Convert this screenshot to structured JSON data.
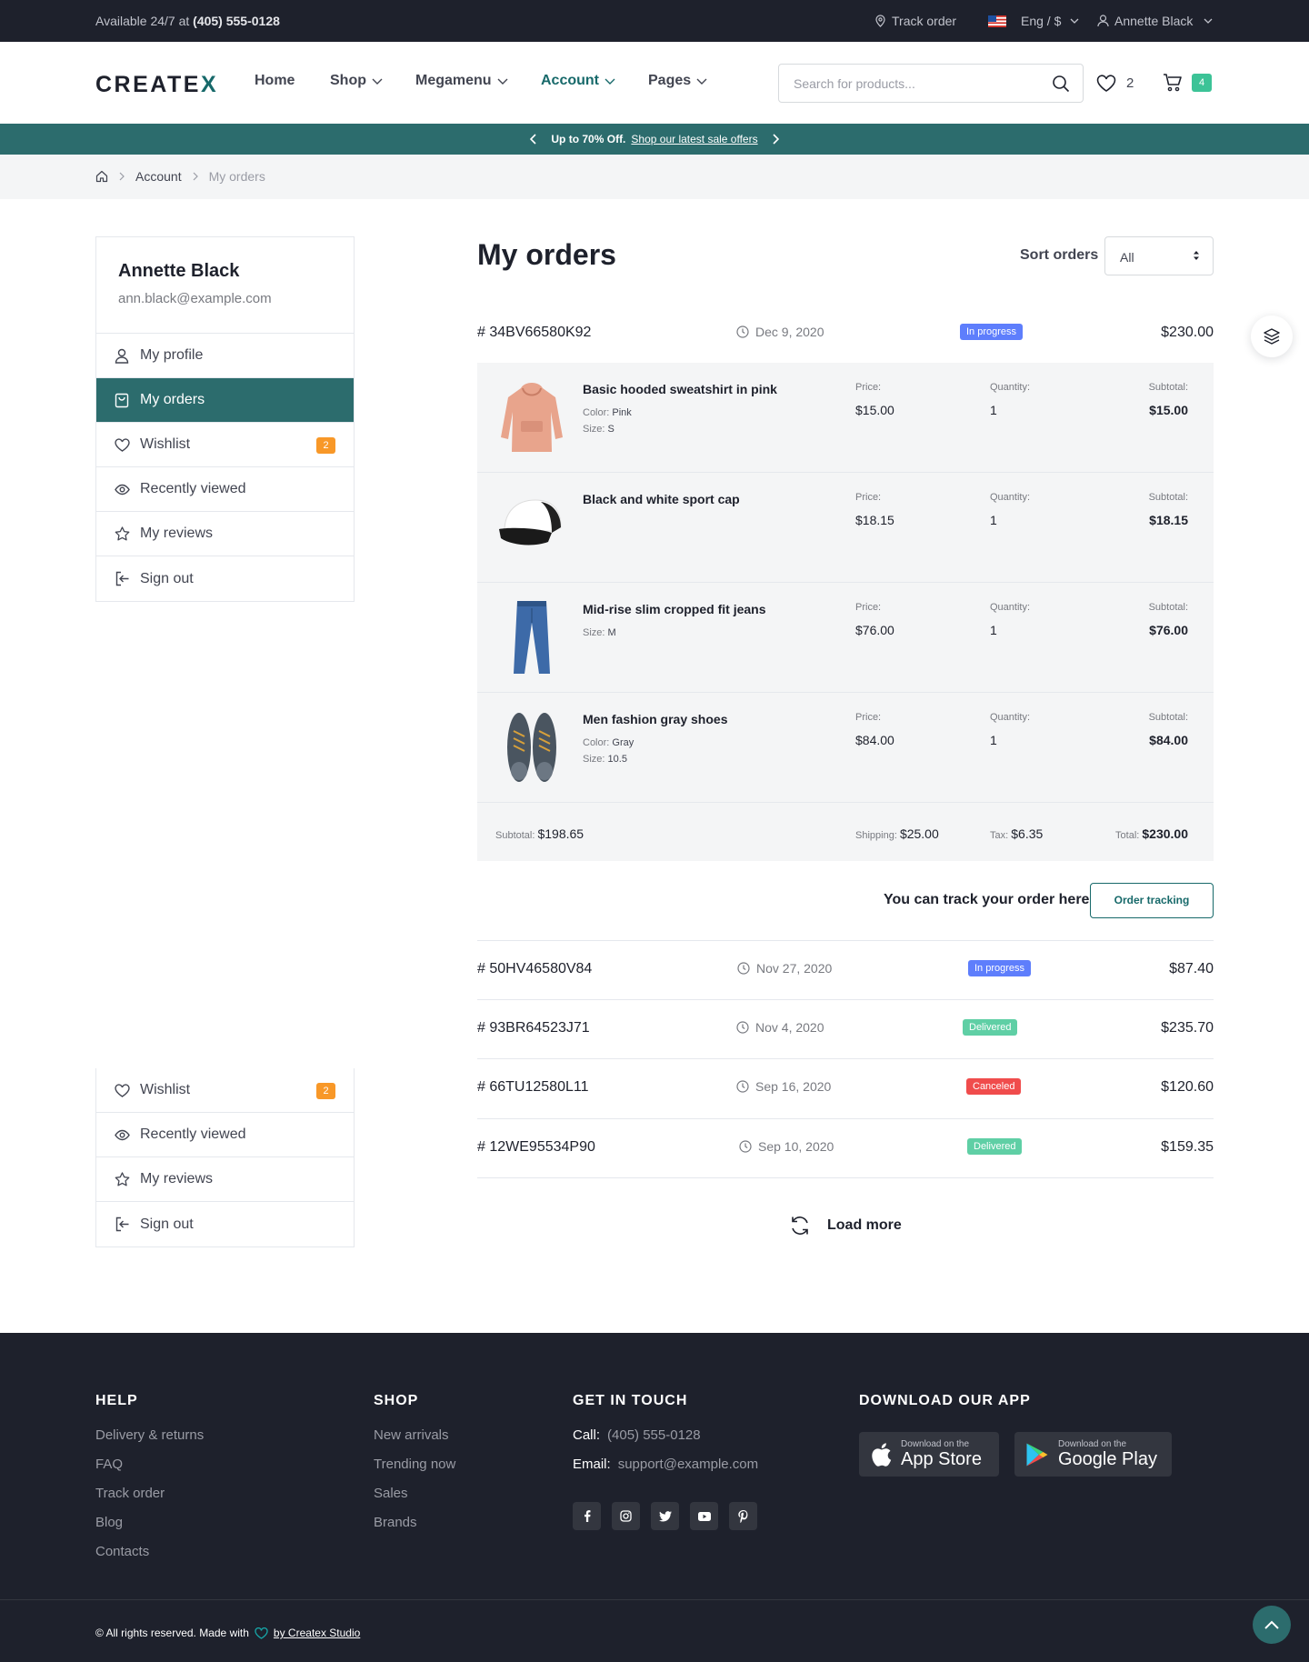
{
  "topbar": {
    "available_text": "Available 24/7 at",
    "phone": "(405) 555-0128",
    "track_order": "Track order",
    "language": "Eng / $",
    "user": "Annette Black"
  },
  "header": {
    "logo_main": "CREATE",
    "logo_accent": "X",
    "nav": [
      "Home",
      "Shop",
      "Megamenu",
      "Account",
      "Pages"
    ],
    "search_placeholder": "Search for products...",
    "wishlist_count": "2",
    "cart_count": "4"
  },
  "promo": {
    "text": "Up to 70% Off.",
    "link": "Shop our latest sale offers"
  },
  "breadcrumb": {
    "account": "Account",
    "current": "My orders"
  },
  "sidebar": {
    "name": "Annette Black",
    "email": "ann.black@example.com",
    "items": [
      "My profile",
      "My orders",
      "Wishlist",
      "Recently viewed",
      "My reviews",
      "Sign out"
    ],
    "wishlist_badge": "2"
  },
  "main": {
    "title": "My orders",
    "sort_label": "Sort orders",
    "sort_value": "All",
    "labels": {
      "price": "Price:",
      "quantity": "Quantity:",
      "subtotal": "Subtotal:",
      "color": "Color:",
      "size": "Size:",
      "shipping": "Shipping:",
      "tax": "Tax:",
      "total": "Total:"
    },
    "orders": [
      {
        "id": "# 34BV66580K92",
        "date": "Dec 9, 2020",
        "status": "In progress",
        "total": "$230.00"
      },
      {
        "id": "# 50HV46580V84",
        "date": "Nov 27, 2020",
        "status": "In progress",
        "total": "$87.40"
      },
      {
        "id": "# 93BR64523J71",
        "date": "Nov 4, 2020",
        "status": "Delivered",
        "total": "$235.70"
      },
      {
        "id": "# 66TU12580L11",
        "date": "Sep 16, 2020",
        "status": "Canceled",
        "total": "$120.60"
      },
      {
        "id": "# 12WE95534P90",
        "date": "Sep 10, 2020",
        "status": "Delivered",
        "total": "$159.35"
      }
    ],
    "items": [
      {
        "name": "Basic hooded sweatshirt in pink",
        "color": "Pink",
        "size": "S",
        "price": "$15.00",
        "qty": "1",
        "subtotal": "$15.00"
      },
      {
        "name": "Black and white sport cap",
        "price": "$18.15",
        "qty": "1",
        "subtotal": "$18.15"
      },
      {
        "name": "Mid-rise slim cropped fit jeans",
        "size": "M",
        "price": "$76.00",
        "qty": "1",
        "subtotal": "$76.00"
      },
      {
        "name": "Men fashion gray shoes",
        "color": "Gray",
        "size": "10.5",
        "price": "$84.00",
        "qty": "1",
        "subtotal": "$84.00"
      }
    ],
    "summary": {
      "subtotal_label": "Subtotal:",
      "subtotal": "$198.65",
      "shipping": "$25.00",
      "tax": "$6.35",
      "total": "$230.00"
    },
    "track_text": "You can track your order here",
    "track_button": "Order tracking",
    "load_more": "Load more"
  },
  "colors": {
    "in_progress": "#5e7efc",
    "delivered": "#5fcfa5",
    "canceled": "#f04c4c",
    "accent": "#17696a"
  },
  "footer": {
    "help_title": "HELP",
    "help_links": [
      "Delivery & returns",
      "FAQ",
      "Track order",
      "Blog",
      "Contacts"
    ],
    "shop_title": "SHOP",
    "shop_links": [
      "New arrivals",
      "Trending now",
      "Sales",
      "Brands"
    ],
    "contact_title": "GET IN TOUCH",
    "call_label": "Call:",
    "call": "(405) 555-0128",
    "email_label": "Email:",
    "email": "support@example.com",
    "app_title": "DOWNLOAD OUR APP",
    "appstore_small": "Download on the",
    "appstore_big": "App Store",
    "googleplay_small": "Download on the",
    "googleplay_big": "Google Play",
    "copyright": "© All rights reserved. Made with",
    "studio": "by Createx Studio"
  }
}
